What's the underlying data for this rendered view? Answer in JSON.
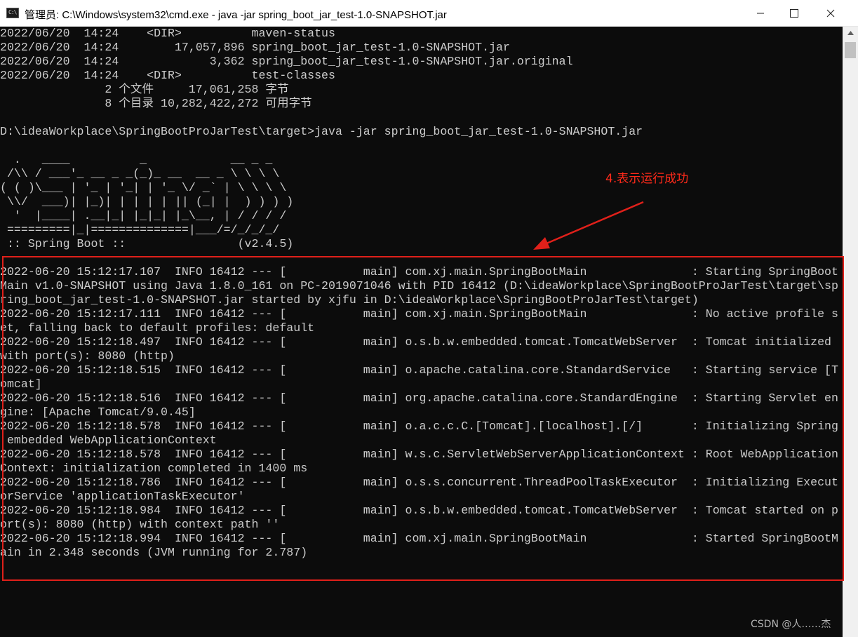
{
  "window": {
    "title": "管理员: C:\\Windows\\system32\\cmd.exe - java  -jar spring_boot_jar_test-1.0-SNAPSHOT.jar",
    "icon_label": "C:\\",
    "buttons": {
      "minimize": "minimize",
      "maximize": "maximize",
      "close": "close"
    }
  },
  "console": {
    "lines": [
      "2022/06/20  14:24    <DIR>          maven-status",
      "2022/06/20  14:24        17,057,896 spring_boot_jar_test-1.0-SNAPSHOT.jar",
      "2022/06/20  14:24             3,362 spring_boot_jar_test-1.0-SNAPSHOT.jar.original",
      "2022/06/20  14:24    <DIR>          test-classes",
      "               2 个文件     17,061,258 字节",
      "               8 个目录 10,282,422,272 可用字节",
      "",
      "D:\\ideaWorkplace\\SpringBootProJarTest\\target>java -jar spring_boot_jar_test-1.0-SNAPSHOT.jar",
      "",
      "  .   ____          _            __ _ _",
      " /\\\\ / ___'_ __ _ _(_)_ __  __ _ \\ \\ \\ \\",
      "( ( )\\___ | '_ | '_| | '_ \\/ _` | \\ \\ \\ \\",
      " \\\\/  ___)| |_)| | | | | || (_| |  ) ) ) )",
      "  '  |____| .__|_| |_|_| |_\\__, | / / / /",
      " =========|_|==============|___/=/_/_/_/",
      " :: Spring Boot ::                (v2.4.5)",
      "",
      "2022-06-20 15:12:17.107  INFO 16412 --- [           main] com.xj.main.SpringBootMain               : Starting SpringBoot",
      "Main v1.0-SNAPSHOT using Java 1.8.0_161 on PC-2019071046 with PID 16412 (D:\\ideaWorkplace\\SpringBootProJarTest\\target\\sp",
      "ring_boot_jar_test-1.0-SNAPSHOT.jar started by xjfu in D:\\ideaWorkplace\\SpringBootProJarTest\\target)",
      "2022-06-20 15:12:17.111  INFO 16412 --- [           main] com.xj.main.SpringBootMain               : No active profile s",
      "et, falling back to default profiles: default",
      "2022-06-20 15:12:18.497  INFO 16412 --- [           main] o.s.b.w.embedded.tomcat.TomcatWebServer  : Tomcat initialized",
      "with port(s): 8080 (http)",
      "2022-06-20 15:12:18.515  INFO 16412 --- [           main] o.apache.catalina.core.StandardService   : Starting service [T",
      "omcat]",
      "2022-06-20 15:12:18.516  INFO 16412 --- [           main] org.apache.catalina.core.StandardEngine  : Starting Servlet en",
      "gine: [Apache Tomcat/9.0.45]",
      "2022-06-20 15:12:18.578  INFO 16412 --- [           main] o.a.c.c.C.[Tomcat].[localhost].[/]       : Initializing Spring",
      " embedded WebApplicationContext",
      "2022-06-20 15:12:18.578  INFO 16412 --- [           main] w.s.c.ServletWebServerApplicationContext : Root WebApplication",
      "Context: initialization completed in 1400 ms",
      "2022-06-20 15:12:18.786  INFO 16412 --- [           main] o.s.s.concurrent.ThreadPoolTaskExecutor  : Initializing Execut",
      "orService 'applicationTaskExecutor'",
      "2022-06-20 15:12:18.984  INFO 16412 --- [           main] o.s.b.w.embedded.tomcat.TomcatWebServer  : Tomcat started on p",
      "ort(s): 8080 (http) with context path ''",
      "2022-06-20 15:12:18.994  INFO 16412 --- [           main] com.xj.main.SpringBootMain               : Started SpringBootM",
      "ain in 2.348 seconds (JVM running for 2.787)"
    ]
  },
  "annotation": {
    "text": "4.表示运行成功",
    "color": "#ff2a1a"
  },
  "watermark": "CSDN @人……杰",
  "colors": {
    "console_bg": "#0c0c0c",
    "console_text": "#cccccc",
    "highlight": "#e0201a"
  }
}
